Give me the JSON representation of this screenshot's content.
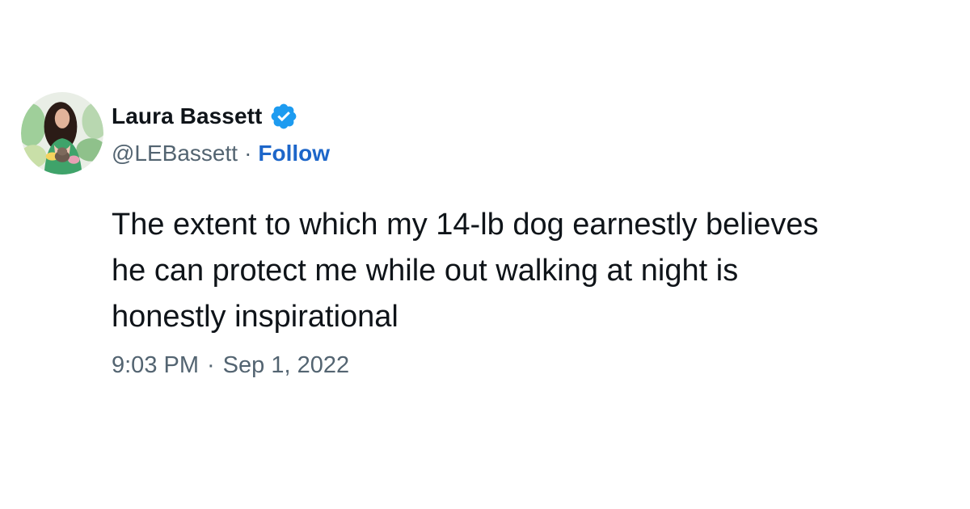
{
  "author": {
    "display_name": "Laura Bassett",
    "handle": "@LEBassett",
    "handle_separator": "·",
    "follow_label": "Follow",
    "verified_icon": "verified-badge-icon",
    "verified_color": "#1d9bf0"
  },
  "tweet": {
    "text": "The extent to which my 14-lb dog earnestly believes\nhe can protect me while out walking at night is\nhonestly inspirational"
  },
  "meta": {
    "time": "9:03 PM",
    "separator": "·",
    "date": "Sep 1, 2022"
  },
  "colors": {
    "text": "#0f1419",
    "secondary": "#536471",
    "follow": "#1d66c9"
  }
}
